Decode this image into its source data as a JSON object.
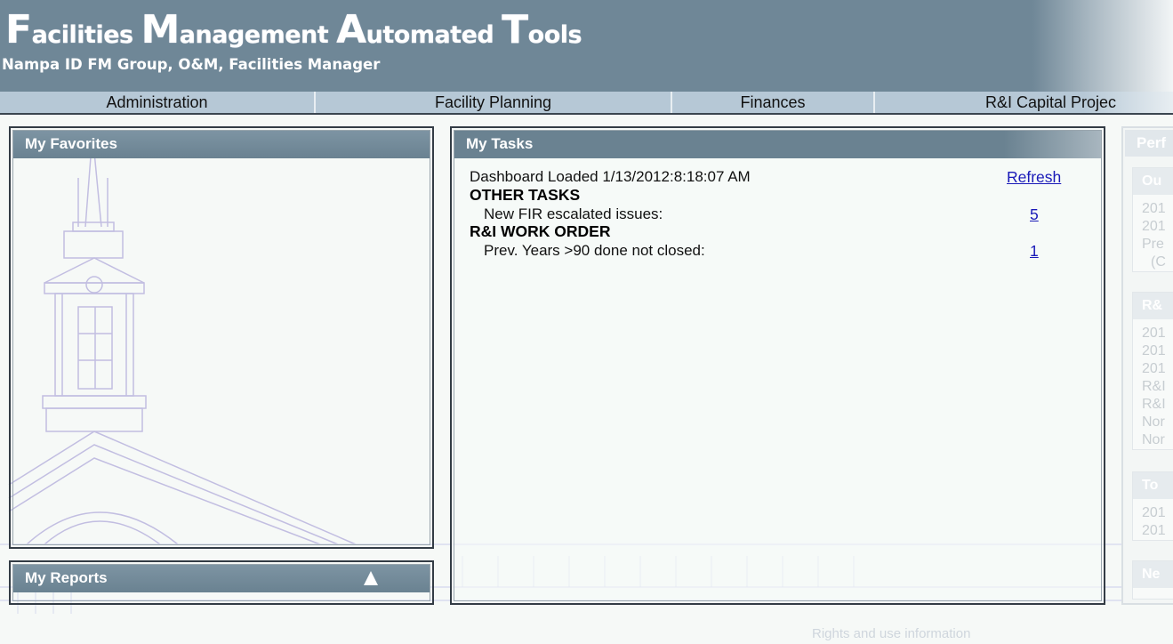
{
  "header": {
    "title_parts": [
      {
        "cap": "F",
        "rest": "acilities "
      },
      {
        "cap": "M",
        "rest": "anagement "
      },
      {
        "cap": "A",
        "rest": "utomated "
      },
      {
        "cap": "T",
        "rest": "ools"
      }
    ],
    "user_line": "Nampa ID FM Group, O&M, Facilities Manager"
  },
  "nav": {
    "items": [
      "Administration",
      "Facility Planning",
      "Finances",
      "R&I Capital Projec"
    ]
  },
  "favorites": {
    "title": "My Favorites"
  },
  "reports": {
    "title": "My Reports",
    "toggle_icon": "collapse-arrow-up-icon"
  },
  "tasks": {
    "title": "My Tasks",
    "loaded_text": "Dashboard Loaded 1/13/2012:8:18:07 AM",
    "refresh_label": "Refresh",
    "sections": [
      {
        "heading": "OTHER TASKS",
        "item_label": "New FIR escalated issues:",
        "count": "5"
      },
      {
        "heading": "R&I WORK ORDER",
        "item_label": "Prev. Years >90 done not closed:",
        "count": "1"
      }
    ]
  },
  "perf": {
    "title": "Perf",
    "blocks": [
      {
        "head": "Ou",
        "lines": [
          "201",
          "201",
          "Pre",
          "(C"
        ]
      },
      {
        "head": "R&",
        "lines": [
          "201",
          "201",
          "201",
          "R&I",
          "R&I",
          "Nor",
          "Nor"
        ]
      },
      {
        "head": "To",
        "lines": [
          "201",
          "201"
        ]
      },
      {
        "head": "Ne",
        "lines": []
      }
    ]
  },
  "footer": {
    "rights_text": "Rights and use information"
  },
  "colors": {
    "header_bg": "#6f8797",
    "nav_bg": "#b6c8d6",
    "panel_header_bg": "#6a8291",
    "link": "#1a1ab8"
  }
}
